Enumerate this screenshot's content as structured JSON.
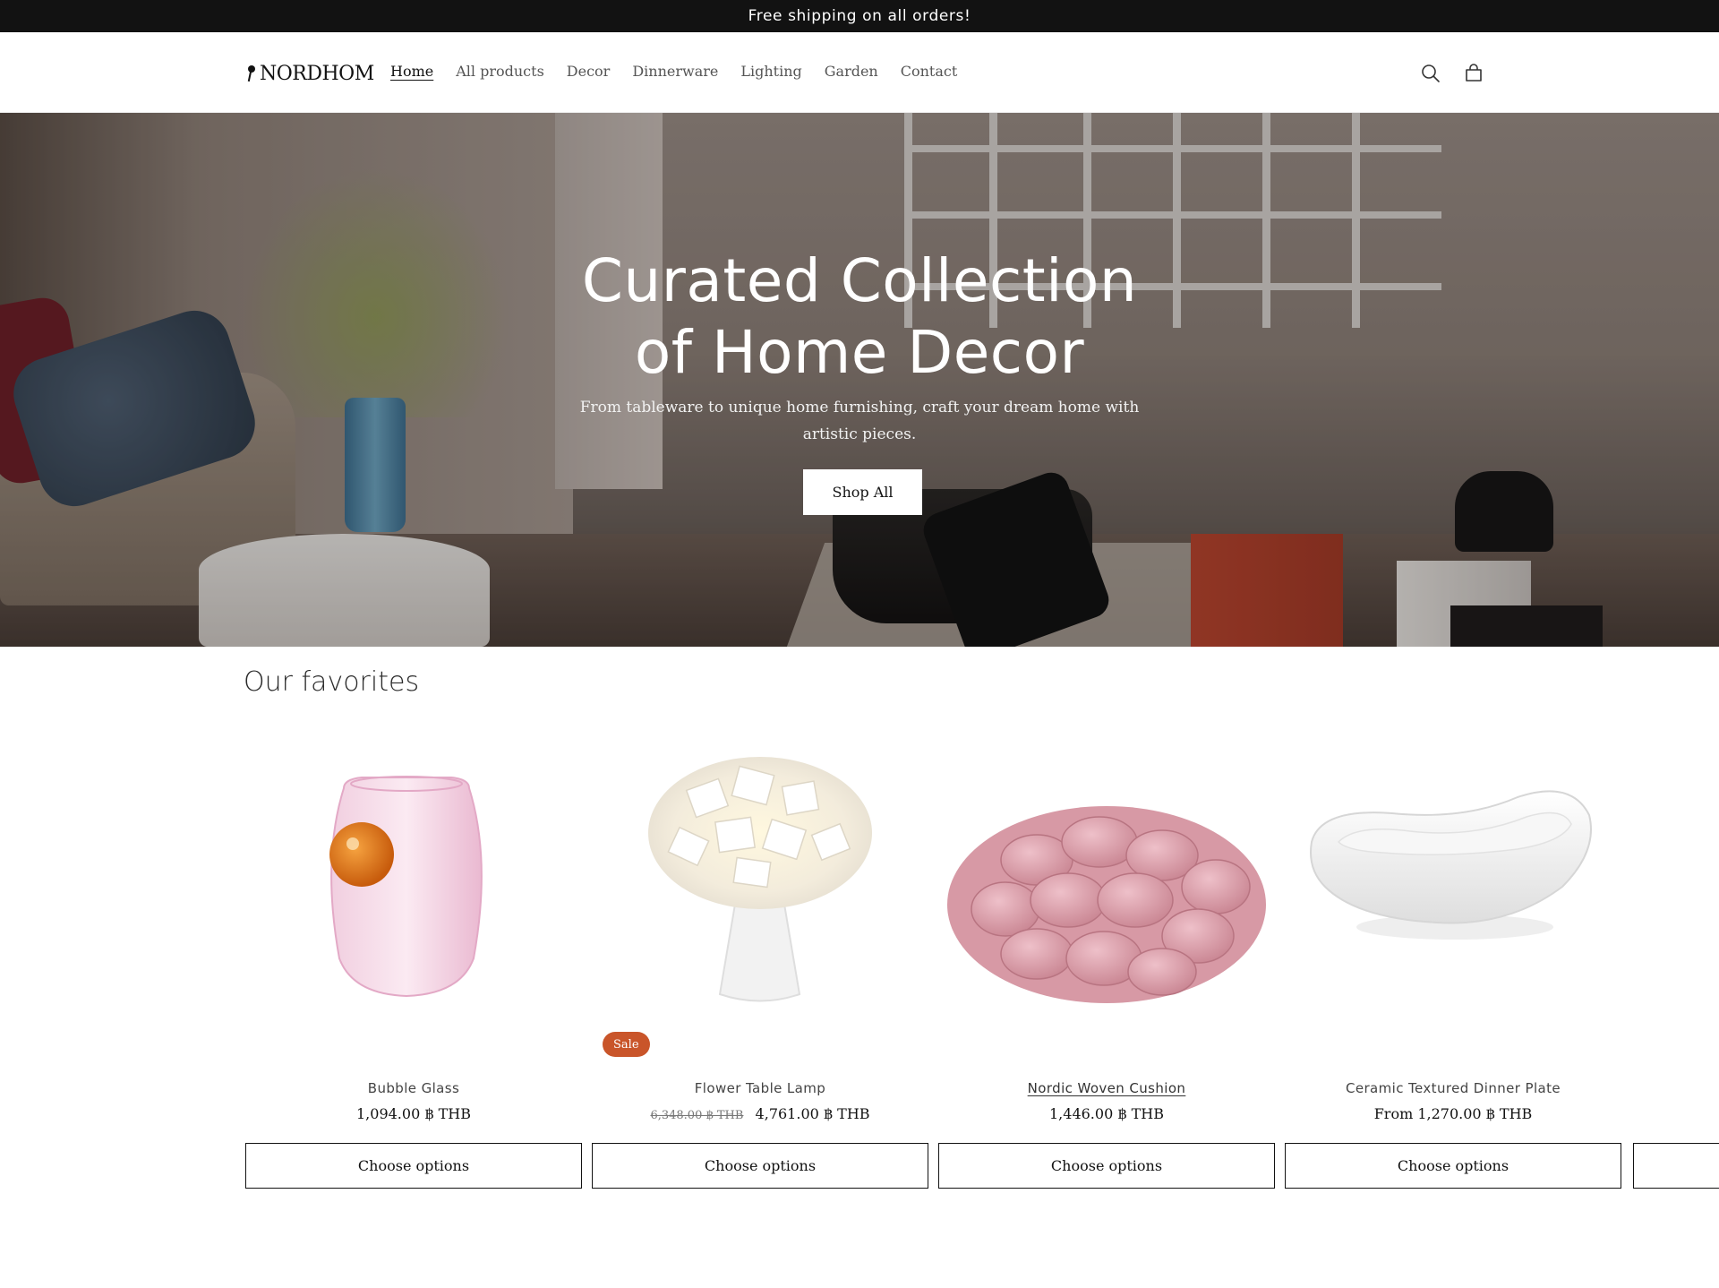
{
  "announcement": {
    "text": "Free shipping on all orders!"
  },
  "header": {
    "logo_text": "NORDHOM",
    "nav": [
      {
        "label": "Home",
        "active": true
      },
      {
        "label": "All products",
        "active": false
      },
      {
        "label": "Decor",
        "active": false
      },
      {
        "label": "Dinnerware",
        "active": false
      },
      {
        "label": "Lighting",
        "active": false
      },
      {
        "label": "Garden",
        "active": false
      },
      {
        "label": "Contact",
        "active": false
      }
    ],
    "icons": [
      "search-icon",
      "cart-icon"
    ]
  },
  "hero": {
    "title_line1": "Curated Collection",
    "title_line2": "of Home Decor",
    "subtitle": "From tableware to unique home furnishing, craft your dream home with artistic pieces.",
    "cta_label": "Shop All"
  },
  "favorites": {
    "title": "Our favorites",
    "products": [
      {
        "name": "Bubble Glass",
        "price": "1,094.00 ฿ THB",
        "button": "Choose options"
      },
      {
        "name": "Flower Table Lamp",
        "old_price": "6,348.00 ฿ THB",
        "price": "4,761.00 ฿ THB",
        "badge": "Sale",
        "button": "Choose options"
      },
      {
        "name": "Nordic Woven Cushion",
        "price": "1,446.00 ฿ THB",
        "button": "Choose options"
      },
      {
        "name": "Ceramic Textured Dinner Plate",
        "price": "From 1,270.00 ฿ THB",
        "button": "Choose options"
      }
    ]
  },
  "colors": {
    "announcement_bg": "#121212",
    "sale_badge": "#c9552a",
    "text": "#121212"
  }
}
